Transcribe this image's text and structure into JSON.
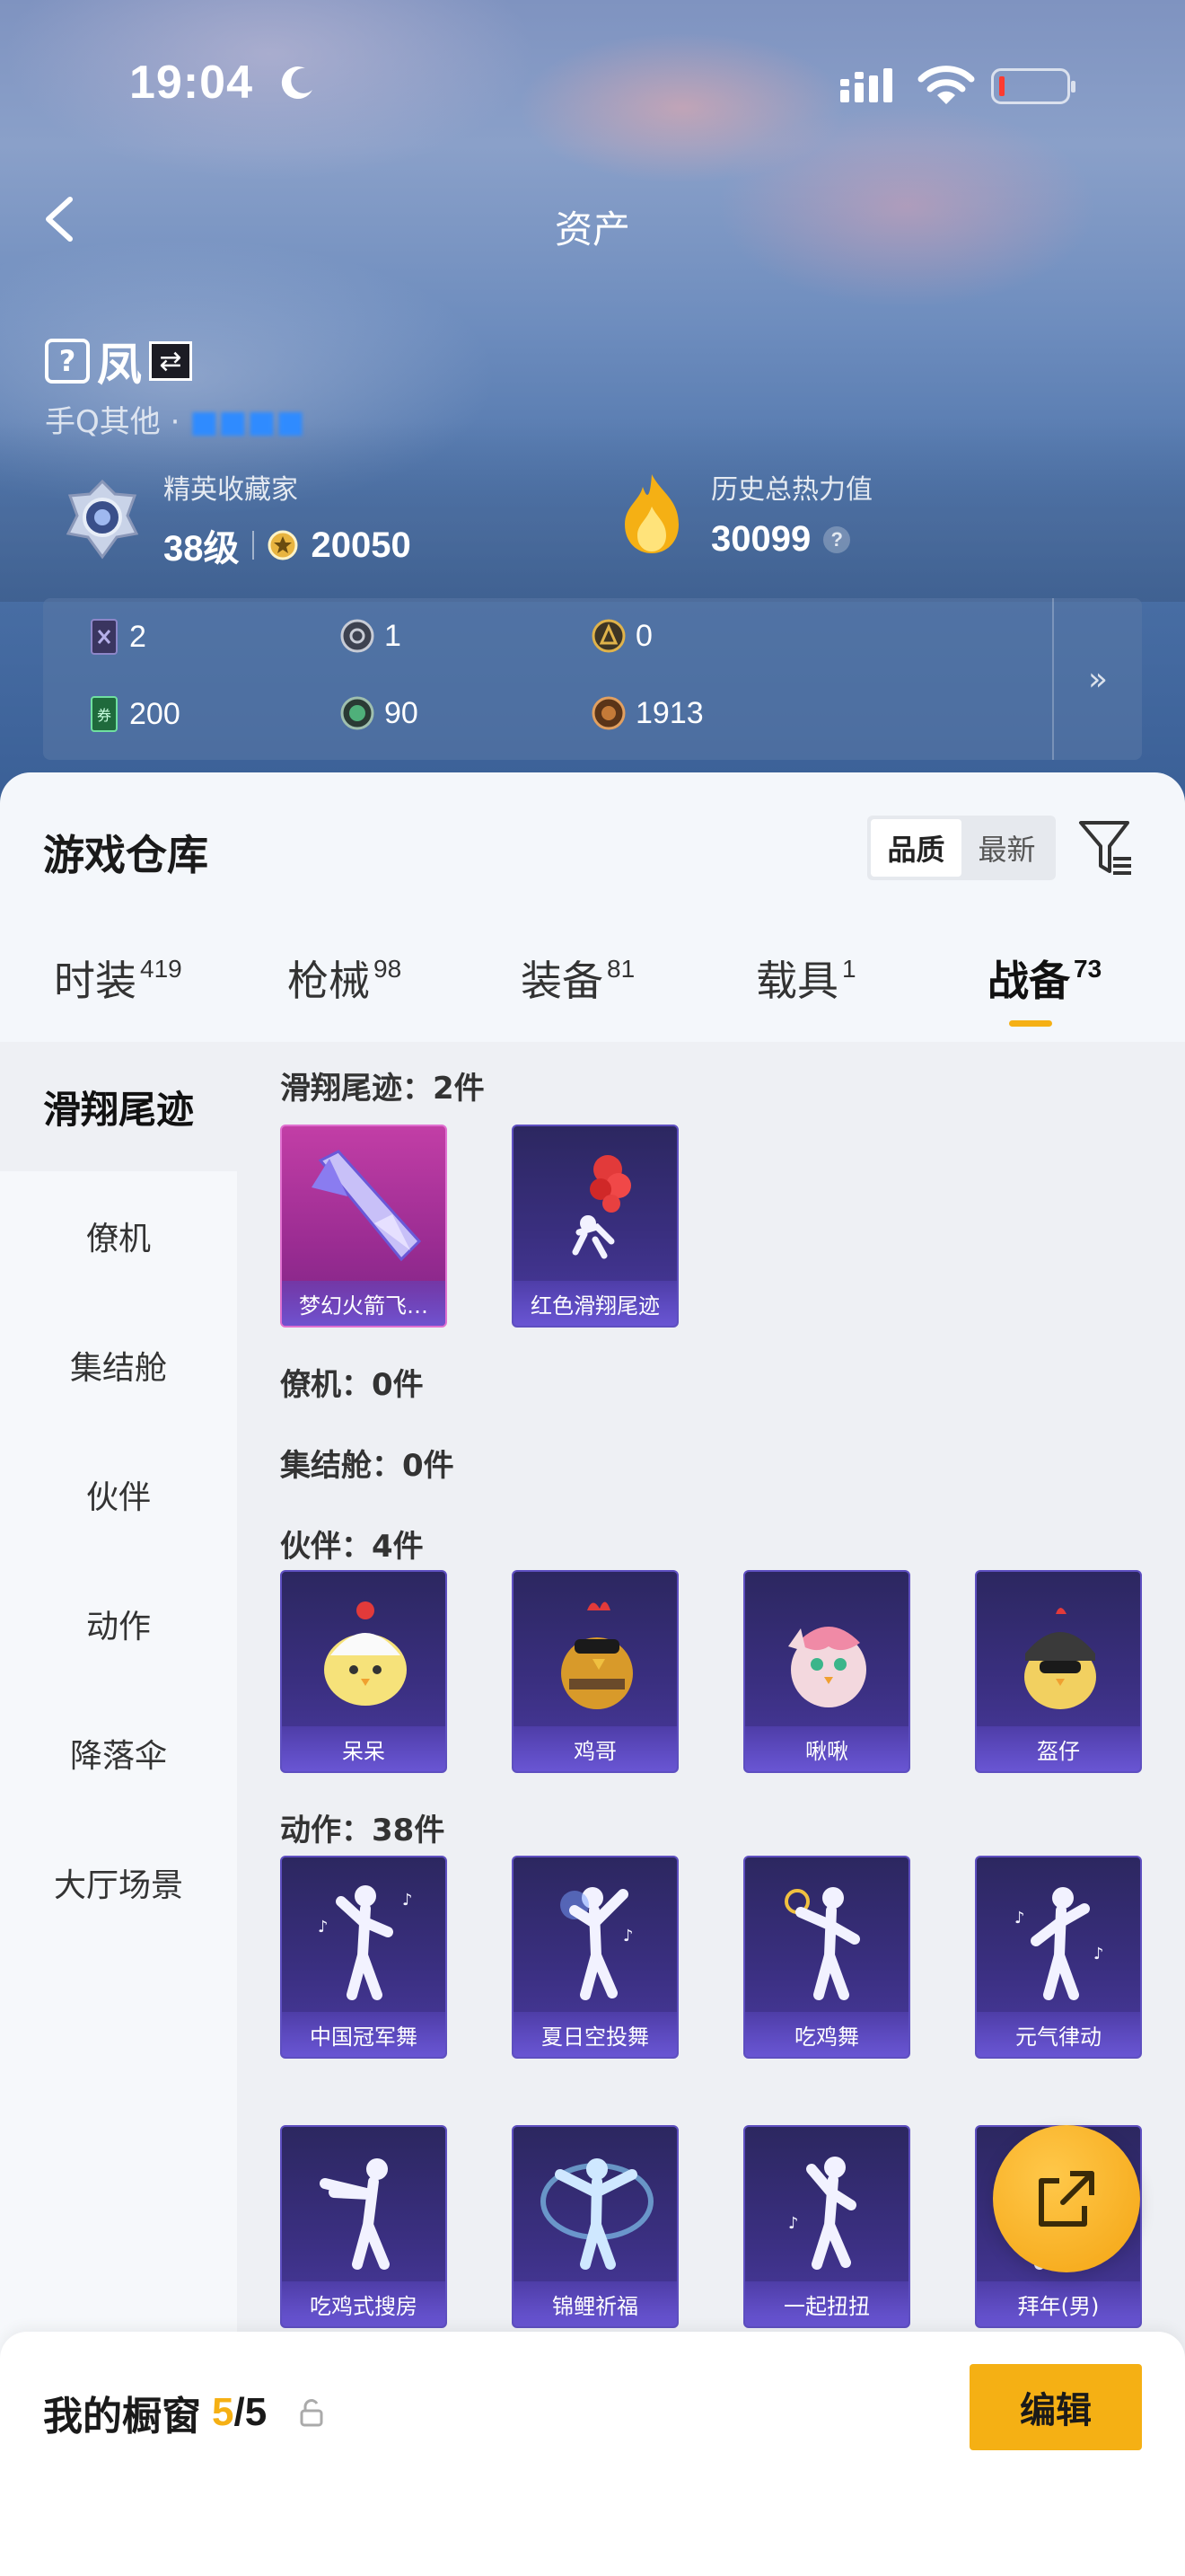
{
  "status_bar": {
    "time": "19:04"
  },
  "nav": {
    "title": "资产"
  },
  "profile": {
    "name": "凤",
    "question_mark": "?",
    "sub_prefix": "手Q其他 · ",
    "sub_status": "■■■■"
  },
  "collector": {
    "label": "精英收藏家",
    "level": "38级",
    "points": "20050"
  },
  "heat": {
    "label": "历史总热力值",
    "value": "30099",
    "help": "?"
  },
  "currencies": [
    {
      "icon": "card-icon",
      "value": "2"
    },
    {
      "icon": "silver-coin-icon",
      "value": "1"
    },
    {
      "icon": "gold-coin-icon",
      "value": "0"
    },
    {
      "icon": "green-ticket-icon",
      "value": "200"
    },
    {
      "icon": "green-orb-icon",
      "value": "90"
    },
    {
      "icon": "bronze-coin-icon",
      "value": "1913"
    }
  ],
  "currency_more": "»",
  "warehouse": {
    "title": "游戏仓库",
    "sort_options": [
      "品质",
      "最新"
    ],
    "active_sort": "品质"
  },
  "tabs": [
    {
      "label": "时装",
      "count": "419"
    },
    {
      "label": "枪械",
      "count": "98"
    },
    {
      "label": "装备",
      "count": "81"
    },
    {
      "label": "载具",
      "count": "1"
    },
    {
      "label": "战备",
      "count": "73"
    }
  ],
  "active_tab": "战备",
  "categories": [
    "滑翔尾迹",
    "僚机",
    "集结舱",
    "伙伴",
    "动作",
    "降落伞",
    "大厅场景"
  ],
  "active_category": "滑翔尾迹",
  "sections": {
    "glide": {
      "title": "滑翔尾迹：2件",
      "items": [
        "梦幻火箭飞…",
        "红色滑翔尾迹"
      ]
    },
    "wingman": {
      "title": "僚机：0件"
    },
    "pod": {
      "title": "集结舱：0件"
    },
    "partner": {
      "title": "伙伴：4件",
      "items": [
        "呆呆",
        "鸡哥",
        "啾啾",
        "盔仔"
      ]
    },
    "emote": {
      "title": "动作：38件",
      "items": [
        "中国冠军舞",
        "夏日空投舞",
        "吃鸡舞",
        "元气律动",
        "吃鸡式搜房",
        "锦鲤祈福",
        "一起扭扭",
        "拜年(男)"
      ]
    }
  },
  "showcase": {
    "label": "我的橱窗",
    "count": "5",
    "total": "/5"
  },
  "edit_button": "编辑",
  "colors": {
    "accent": "#f5b014",
    "card_purple": "#3a2f80",
    "card_pink": "#c23ea6"
  }
}
